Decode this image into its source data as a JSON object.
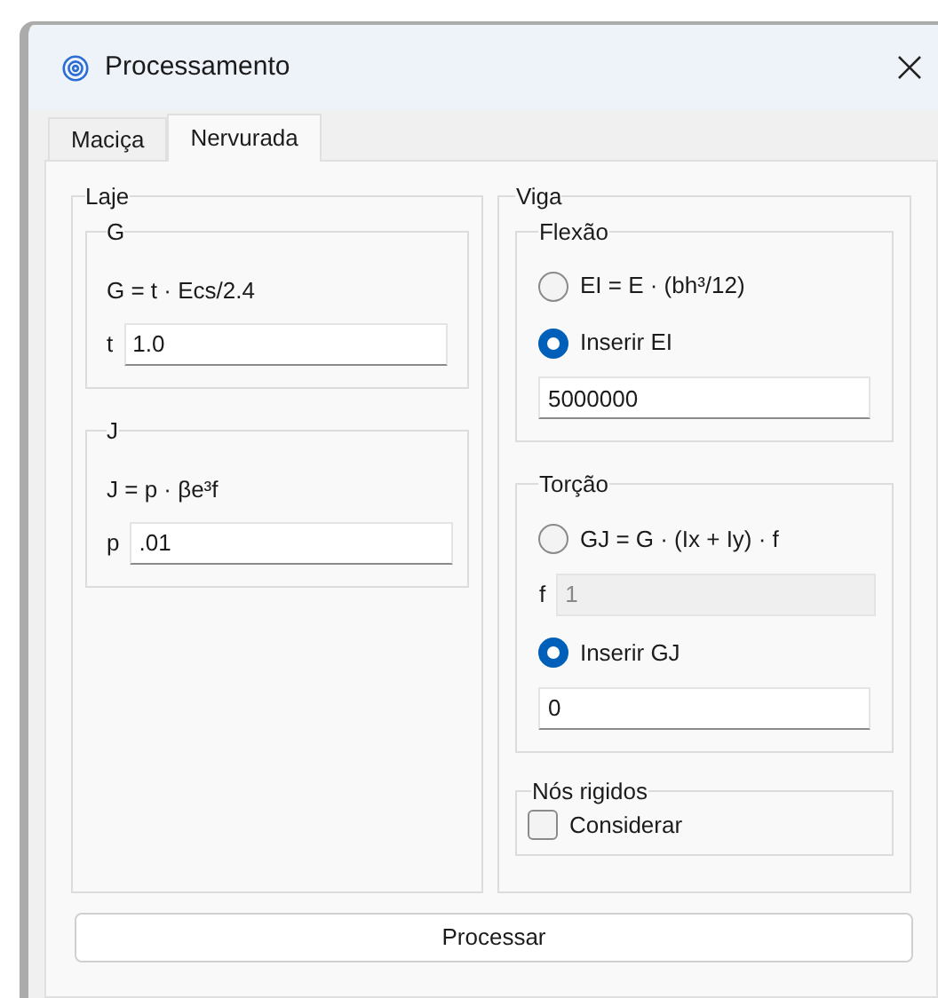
{
  "window": {
    "title": "Processamento"
  },
  "tabs": [
    {
      "label": "Maciça",
      "selected": false
    },
    {
      "label": "Nervurada",
      "selected": true
    }
  ],
  "laje": {
    "title": "Laje",
    "groups": [
      {
        "title": "G",
        "formula": "G = t · Ecs/2.4",
        "field": {
          "label": "t",
          "value": "1.0"
        }
      },
      {
        "title": "J",
        "formula": "J = p · βe³f",
        "field": {
          "label": "p",
          "value": ".01"
        }
      }
    ]
  },
  "viga": {
    "title": "Viga",
    "groups": [
      {
        "title": "Flexão",
        "items": [
          {
            "kind": "radio",
            "label": "EI = E · (bh³/12)",
            "selected": false
          },
          {
            "kind": "radio",
            "label": "Inserir EI",
            "selected": true
          },
          {
            "kind": "field",
            "value": "5000000",
            "disabled": false
          }
        ]
      },
      {
        "title": "Torção",
        "items": [
          {
            "kind": "radio",
            "label": "GJ = G · (Ix + Iy) · f",
            "selected": false
          },
          {
            "kind": "field",
            "label": "f",
            "value": "1",
            "disabled": true
          },
          {
            "kind": "radio",
            "label": "Inserir GJ",
            "selected": true
          },
          {
            "kind": "field",
            "value": "0",
            "disabled": false
          }
        ]
      }
    ],
    "nos_rigidos": {
      "title": "Nós rigidos",
      "checkbox": {
        "label": "Considerar",
        "checked": false
      }
    }
  },
  "button": "Processar"
}
